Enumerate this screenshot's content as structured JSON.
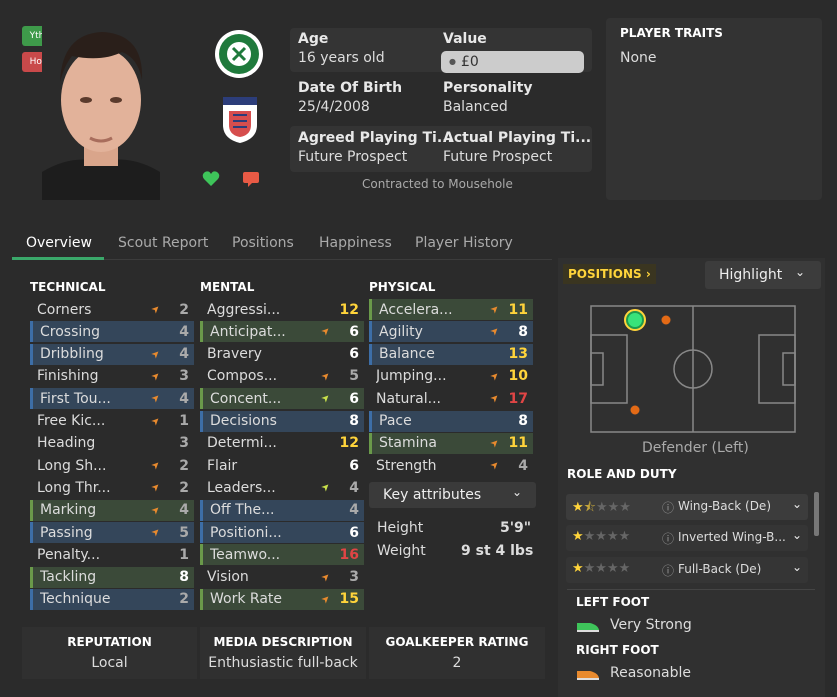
{
  "badges": {
    "yth": "Yth",
    "hol": "Hol"
  },
  "info": {
    "age_label": "Age",
    "age": "16 years old",
    "value_label": "Value",
    "value": "£0",
    "dob_label": "Date Of Birth",
    "dob": "25/4/2008",
    "personality_label": "Personality",
    "personality": "Balanced",
    "agreed_label": "Agreed Playing Ti...",
    "agreed": "Future Prospect",
    "actual_label": "Actual Playing Ti...",
    "actual": "Future Prospect",
    "contract": "Contracted to Mousehole"
  },
  "traits": {
    "title": "PLAYER TRAITS",
    "value": "None"
  },
  "tabs": [
    "Overview",
    "Scout Report",
    "Positions",
    "Happiness",
    "Player History"
  ],
  "technical": {
    "title": "TECHNICAL",
    "rows": [
      {
        "name": "Corners",
        "value": "2"
      },
      {
        "name": "Crossing",
        "value": "4"
      },
      {
        "name": "Dribbling",
        "value": "4"
      },
      {
        "name": "Finishing",
        "value": "3"
      },
      {
        "name": "First Tou...",
        "value": "4"
      },
      {
        "name": "Free Kic...",
        "value": "1"
      },
      {
        "name": "Heading",
        "value": "3"
      },
      {
        "name": "Long Sh...",
        "value": "2"
      },
      {
        "name": "Long Thr...",
        "value": "2"
      },
      {
        "name": "Marking",
        "value": "4"
      },
      {
        "name": "Passing",
        "value": "5"
      },
      {
        "name": "Penalty...",
        "value": "1"
      },
      {
        "name": "Tackling",
        "value": "8"
      },
      {
        "name": "Technique",
        "value": "2"
      }
    ]
  },
  "mental": {
    "title": "MENTAL",
    "rows": [
      {
        "name": "Aggressi...",
        "value": "12"
      },
      {
        "name": "Anticipat...",
        "value": "6"
      },
      {
        "name": "Bravery",
        "value": "6"
      },
      {
        "name": "Compos...",
        "value": "5"
      },
      {
        "name": "Concent...",
        "value": "6"
      },
      {
        "name": "Decisions",
        "value": "8"
      },
      {
        "name": "Determi...",
        "value": "12"
      },
      {
        "name": "Flair",
        "value": "6"
      },
      {
        "name": "Leaders...",
        "value": "4"
      },
      {
        "name": "Off The...",
        "value": "4"
      },
      {
        "name": "Positioni...",
        "value": "6"
      },
      {
        "name": "Teamwo...",
        "value": "16"
      },
      {
        "name": "Vision",
        "value": "3"
      },
      {
        "name": "Work Rate",
        "value": "15"
      }
    ]
  },
  "physical": {
    "title": "PHYSICAL",
    "rows": [
      {
        "name": "Accelera...",
        "value": "11"
      },
      {
        "name": "Agility",
        "value": "8"
      },
      {
        "name": "Balance",
        "value": "13"
      },
      {
        "name": "Jumping...",
        "value": "10"
      },
      {
        "name": "Natural...",
        "value": "17"
      },
      {
        "name": "Pace",
        "value": "8"
      },
      {
        "name": "Stamina",
        "value": "11"
      },
      {
        "name": "Strength",
        "value": "4"
      }
    ]
  },
  "key_attributes": "Key attributes",
  "height_label": "Height",
  "height": "5'9\"",
  "weight_label": "Weight",
  "weight": "9 st 4 lbs",
  "positions": {
    "title": "POSITIONS",
    "highlight": "Highlight",
    "position_name": "Defender (Left)"
  },
  "role_duty": {
    "title": "ROLE AND DUTY",
    "roles": [
      {
        "name": "Wing-Back (De)",
        "stars": 1.5
      },
      {
        "name": "Inverted Wing-B...",
        "stars": 1
      },
      {
        "name": "Full-Back (De)",
        "stars": 1
      }
    ]
  },
  "feet": {
    "left_title": "LEFT FOOT",
    "left": "Very Strong",
    "right_title": "RIGHT FOOT",
    "right": "Reasonable"
  },
  "bottom": {
    "reputation_title": "REPUTATION",
    "reputation": "Local",
    "media_title": "MEDIA DESCRIPTION",
    "media": "Enthusiastic full-back",
    "gk_title": "GOALKEEPER RATING",
    "gk": "2"
  },
  "colors": {
    "blue_row": "#34465a",
    "green_row": "#3b4a39",
    "accent_yellow": "#ffd43b",
    "accent_red": "#e04545",
    "accent_orange": "#e88a2e"
  }
}
